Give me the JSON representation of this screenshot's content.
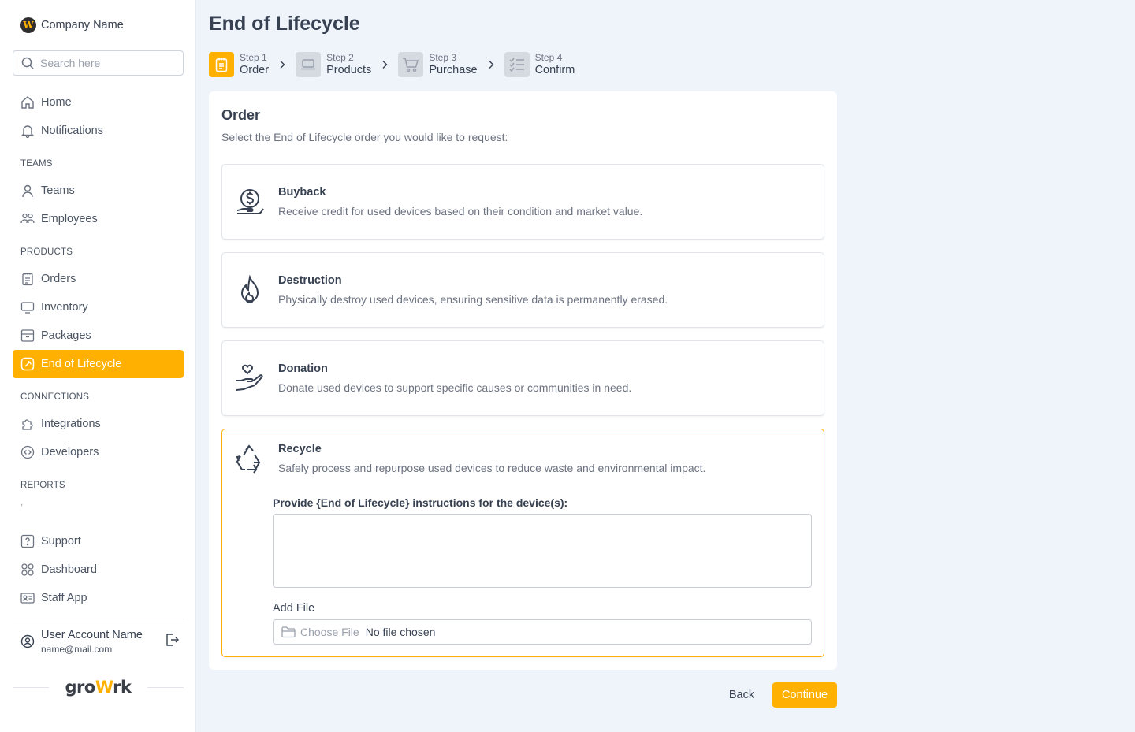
{
  "brand": {
    "logo_letter": "W",
    "name": "Company Name"
  },
  "search": {
    "placeholder": "Search here"
  },
  "sidebar": {
    "top_items": [
      {
        "label": "Home",
        "icon": "home-icon"
      },
      {
        "label": "Notifications",
        "icon": "bell-icon"
      }
    ],
    "sections": [
      {
        "title": "TEAMS",
        "items": [
          {
            "label": "Teams",
            "icon": "user-icon"
          },
          {
            "label": "Employees",
            "icon": "users-icon"
          }
        ]
      },
      {
        "title": "PRODUCTS",
        "items": [
          {
            "label": "Orders",
            "icon": "clipboard-icon"
          },
          {
            "label": "Inventory",
            "icon": "monitor-icon"
          },
          {
            "label": "Packages",
            "icon": "archive-icon"
          },
          {
            "label": "End of Lifecycle",
            "icon": "gauge-icon",
            "active": true
          }
        ]
      },
      {
        "title": "CONNECTIONS",
        "items": [
          {
            "label": "Integrations",
            "icon": "puzzle-icon"
          },
          {
            "label": "Developers",
            "icon": "code-icon"
          }
        ]
      },
      {
        "title": "REPORTS",
        "items": []
      }
    ],
    "reports_placeholder": ",",
    "bottom_items": [
      {
        "label": "Support",
        "icon": "help-icon"
      },
      {
        "label": "Dashboard",
        "icon": "grid-icon"
      },
      {
        "label": "Staff App",
        "icon": "id-card-icon"
      }
    ],
    "user": {
      "name": "User Account Name",
      "email": "name@mail.com"
    },
    "footer_logo": {
      "pre": "gro",
      "accent": "W",
      "post": "rk"
    }
  },
  "page": {
    "title": "End of Lifecycle"
  },
  "stepper": [
    {
      "num": "Step 1",
      "label": "Order",
      "icon": "clipboard-icon",
      "active": true
    },
    {
      "num": "Step 2",
      "label": "Products",
      "icon": "laptop-icon",
      "active": false
    },
    {
      "num": "Step 3",
      "label": "Purchase",
      "icon": "cart-icon",
      "active": false
    },
    {
      "num": "Step 4",
      "label": "Confirm",
      "icon": "checklist-icon",
      "active": false
    }
  ],
  "order": {
    "title": "Order",
    "subtitle": "Select the End of Lifecycle order you would like to request:",
    "options": [
      {
        "title": "Buyback",
        "desc": "Receive credit for used devices based on their condition and market value.",
        "icon": "dollar-hand-icon"
      },
      {
        "title": "Destruction",
        "desc": "Physically destroy used devices, ensuring sensitive data is permanently erased.",
        "icon": "flame-icon"
      },
      {
        "title": "Donation",
        "desc": "Donate used devices to support specific causes or communities in need.",
        "icon": "heart-hand-icon"
      },
      {
        "title": "Recycle",
        "desc": "Safely process and repurpose used devices to reduce waste and environmental impact.",
        "icon": "recycle-icon",
        "selected": true
      }
    ],
    "instructions_label": "Provide {End of Lifecycle} instructions for the device(s):",
    "instructions_value": "",
    "file_label": "Add File",
    "file_choose": "Choose File",
    "file_status": "No file chosen"
  },
  "actions": {
    "back": "Back",
    "continue": "Continue"
  },
  "colors": {
    "accent": "#ffb000",
    "background": "#eff3fa",
    "text": "#374151",
    "muted": "#6b7280"
  }
}
